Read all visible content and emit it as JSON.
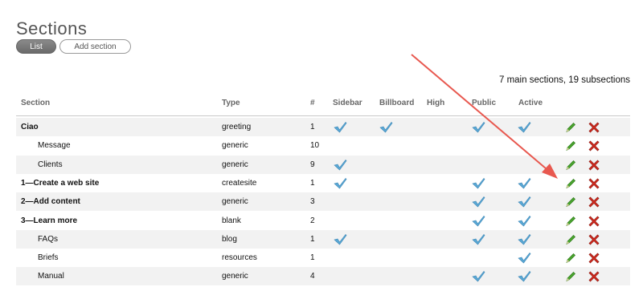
{
  "page": {
    "title": "Sections"
  },
  "tabs": [
    {
      "label": "List",
      "active": true
    },
    {
      "label": "Add section",
      "active": false
    }
  ],
  "summary": "7 main sections, 19 subsections",
  "table": {
    "headers": {
      "section": "Section",
      "type": "Type",
      "number": "#",
      "sidebar": "Sidebar",
      "billboard": "Billboard",
      "high": "High",
      "public": "Public",
      "active": "Active"
    },
    "rows": [
      {
        "name": "Ciao",
        "level": "main",
        "type": "greeting",
        "number": "1",
        "sidebar": true,
        "billboard": true,
        "high": false,
        "public": true,
        "active": true
      },
      {
        "name": "Message",
        "level": "sub",
        "type": "generic",
        "number": "10",
        "sidebar": false,
        "billboard": false,
        "high": false,
        "public": false,
        "active": false
      },
      {
        "name": "Clients",
        "level": "sub",
        "type": "generic",
        "number": "9",
        "sidebar": true,
        "billboard": false,
        "high": false,
        "public": false,
        "active": false
      },
      {
        "name": "1—Create a web site",
        "level": "main",
        "type": "createsite",
        "number": "1",
        "sidebar": true,
        "billboard": false,
        "high": false,
        "public": true,
        "active": true
      },
      {
        "name": "2—Add content",
        "level": "main",
        "type": "generic",
        "number": "3",
        "sidebar": false,
        "billboard": false,
        "high": false,
        "public": true,
        "active": true
      },
      {
        "name": "3—Learn more",
        "level": "main",
        "type": "blank",
        "number": "2",
        "sidebar": false,
        "billboard": false,
        "high": false,
        "public": true,
        "active": true
      },
      {
        "name": "FAQs",
        "level": "sub",
        "type": "blog",
        "number": "1",
        "sidebar": true,
        "billboard": false,
        "high": false,
        "public": true,
        "active": true
      },
      {
        "name": "Briefs",
        "level": "sub",
        "type": "resources",
        "number": "1",
        "sidebar": false,
        "billboard": false,
        "high": false,
        "public": false,
        "active": true
      },
      {
        "name": "Manual",
        "level": "sub",
        "type": "generic",
        "number": "4",
        "sidebar": false,
        "billboard": false,
        "high": false,
        "public": true,
        "active": true
      }
    ],
    "row_actions": {
      "edit_icon": "pencil-icon",
      "delete_icon": "delete-x-icon"
    }
  },
  "annotation": {
    "type": "arrow",
    "color": "#e8584f",
    "target": "edit action of row 1—Create a web site"
  },
  "colors": {
    "check": "#5aa9d6",
    "pencil": "#4aa52e",
    "delete": "#d62b1f",
    "alt_row": "#f2f2f2",
    "active_tab": "#777777"
  }
}
